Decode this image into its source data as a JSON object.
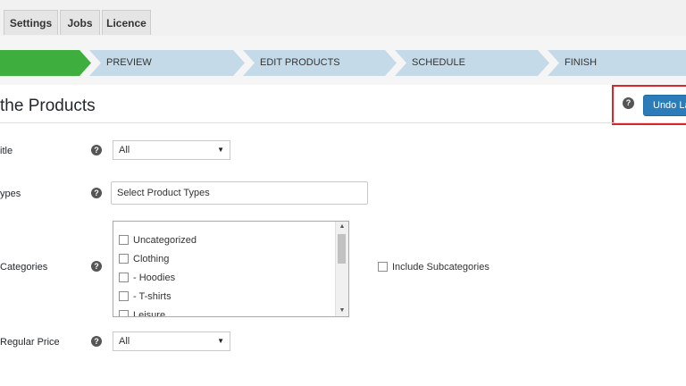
{
  "tabs": [
    {
      "label": "Settings"
    },
    {
      "label": "Jobs"
    },
    {
      "label": "Licence"
    }
  ],
  "steps": [
    {
      "label": "",
      "status": "active"
    },
    {
      "label": "PREVIEW"
    },
    {
      "label": "EDIT PRODUCTS"
    },
    {
      "label": "SCHEDULE"
    },
    {
      "label": "FINISH"
    }
  ],
  "heading": "the Products",
  "undo_button": {
    "label": "Undo La"
  },
  "help_icon": "question-circle-icon",
  "fields": {
    "title": {
      "label": "itle",
      "value": "All"
    },
    "types": {
      "label": "ypes",
      "placeholder": "Select Product Types"
    },
    "categories": {
      "label": "Categories",
      "options": [
        "Uncategorized",
        "Clothing",
        "- Hoodies",
        "- T-shirts",
        "Leisure"
      ],
      "include_subcategories": "Include Subcategories"
    },
    "regular_price": {
      "label": "Regular Price",
      "value": "All"
    }
  },
  "colors": {
    "active_step": "#3eae3e",
    "step": "#c5dae8",
    "primary_button": "#2b7cb8",
    "highlight_box": "#d9262c"
  }
}
